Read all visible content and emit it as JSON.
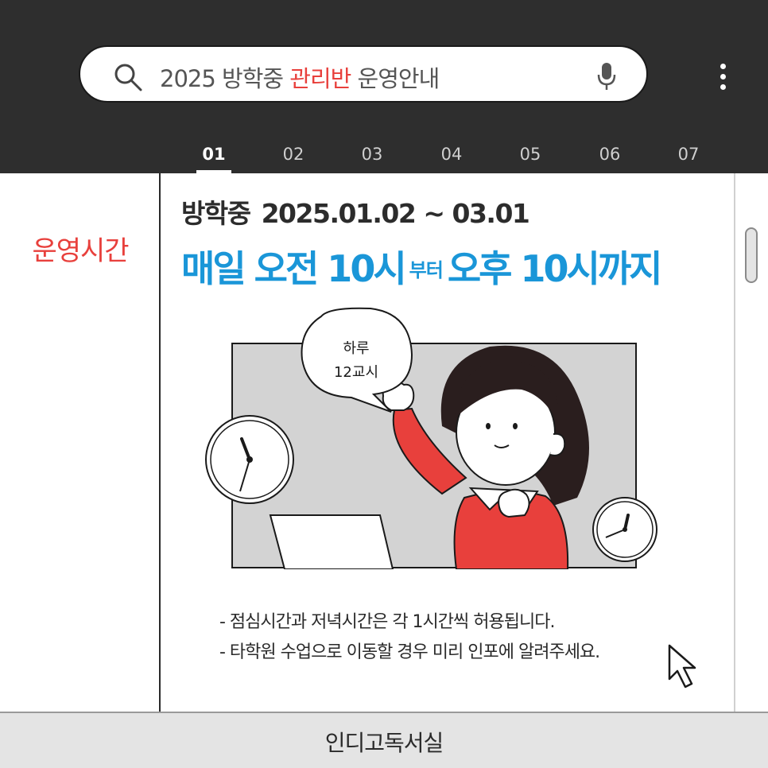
{
  "search": {
    "text_before": "2025 방학중 ",
    "text_highlight": "관리반",
    "text_after": " 운영안내",
    "icon": "search-icon",
    "mic_icon": "mic-icon",
    "menu_icon": "kebab-menu-icon"
  },
  "tabs": [
    {
      "label": "01",
      "active": true
    },
    {
      "label": "02",
      "active": false
    },
    {
      "label": "03",
      "active": false
    },
    {
      "label": "04",
      "active": false
    },
    {
      "label": "05",
      "active": false
    },
    {
      "label": "06",
      "active": false
    },
    {
      "label": "07",
      "active": false
    }
  ],
  "section": {
    "label": "운영시간"
  },
  "schedule": {
    "period_prefix": "방학중",
    "period_dates": "2025.01.02 ~ 03.01",
    "hours_start": "매일 오전 10시",
    "hours_connector": "부터",
    "hours_end": "오후 10시까지"
  },
  "illustration": {
    "speech_line1": "하루",
    "speech_line2": "12교시"
  },
  "notes": [
    "- 점심시간과 저녁시간은 각  1시간씩 허용됩니다.",
    "- 타학원 수업으로 이동할 경우 미리 인포에 알려주세요."
  ],
  "footer": {
    "label": "인디고독서실"
  },
  "colors": {
    "header_bg": "#2e2e2e",
    "accent_red": "#e8403c",
    "accent_blue": "#1a96d8",
    "footer_bg": "#e4e4e4"
  }
}
